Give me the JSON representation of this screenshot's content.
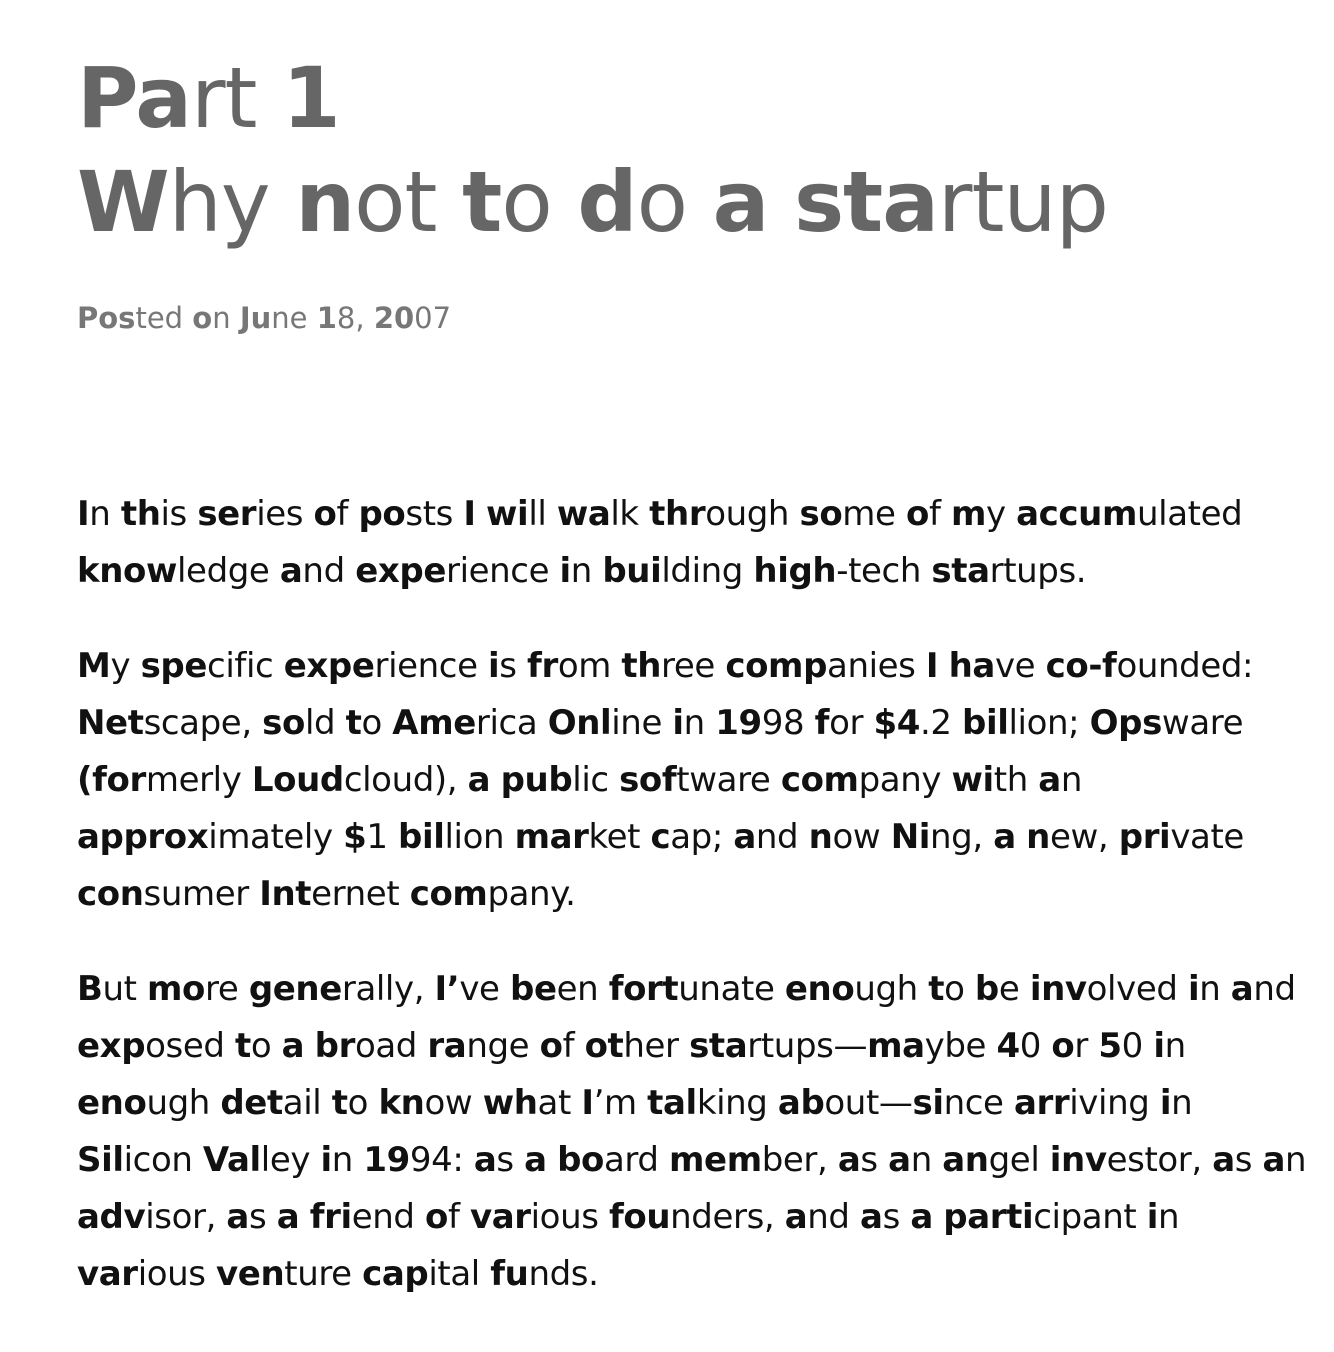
{
  "article": {
    "title_line1": "Part 1",
    "title_line2": "Why not to do a startup",
    "posted": "Posted on June 18, 2007",
    "paragraphs": [
      "In this series of posts I will walk through some of my accumulated knowledge and experience in building high-tech startups.",
      "My specific experience is from three companies I have co-founded: Netscape, sold to America Online in 1998 for $4.2 billion; Opsware (formerly Loudcloud), a public software company with an approximately $1 billion market cap; and now Ning, a new, private consumer Internet company.",
      "But more generally, I’ve been fortunate enough to be involved in and exposed to a broad range of other startups—maybe 40 or 50 in enough detail to know what I’m talking about—since arriving in Silicon Valley in 1994: as a board member, as an angel investor, as an advisor, as a friend of various founders, and as a participant in various venture capital funds."
    ]
  },
  "style": {
    "text_color": "#111111",
    "title_color": "#666666",
    "meta_color": "#777777",
    "bionic_reading": true
  }
}
